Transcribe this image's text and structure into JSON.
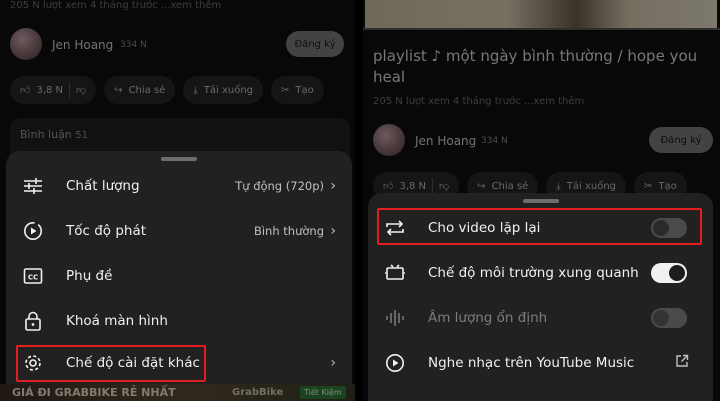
{
  "left": {
    "meta": "205 N lượt xem  4 tháng trước  ...xem thêm",
    "channel": {
      "name": "Jen Hoang",
      "subs": "334 N",
      "subscribe_label": "Đăng ký"
    },
    "actions": {
      "likes": "3,8 N",
      "share": "Chia sẻ",
      "download": "Tải xuống",
      "clip": "Tạo"
    },
    "comments": {
      "label": "Bình luận",
      "count": "51"
    },
    "menu": [
      {
        "label": "Chất lượng",
        "value": "Tự động (720p)",
        "icon": "sliders-icon"
      },
      {
        "label": "Tốc độ phát",
        "value": "Bình thường",
        "icon": "playback-speed-icon"
      },
      {
        "label": "Phụ đề",
        "value": "",
        "icon": "captions-icon"
      },
      {
        "label": "Khoá màn hình",
        "value": "",
        "icon": "lock-icon"
      },
      {
        "label": "Chế độ cài đặt khác",
        "value": "",
        "icon": "gear-icon"
      }
    ],
    "banner": {
      "text": "GIÁ ĐI GRABBIKE RẺ NHẤT",
      "tag": "Tiết Kiệm",
      "brand": "GrabBike"
    }
  },
  "right": {
    "title": "playlist ♪ một ngày bình thường / hope you heal",
    "meta": "205 N lượt xem  4 tháng trước  ...xem thêm",
    "channel": {
      "name": "Jen Hoang",
      "subs": "334 N",
      "subscribe_label": "Đăng ký"
    },
    "actions": {
      "likes": "3,8 N",
      "share": "Chia sẻ",
      "download": "Tải xuống",
      "clip": "Tạo"
    },
    "menu": [
      {
        "label": "Cho video lặp lại",
        "state": "off",
        "icon": "repeat-icon"
      },
      {
        "label": "Chế độ môi trường xung quanh",
        "state": "on",
        "icon": "ambient-tv-icon"
      },
      {
        "label": "Âm lượng ổn định",
        "state": "off-disabled",
        "icon": "stable-volume-icon"
      },
      {
        "label": "Nghe nhạc trên YouTube Music",
        "state": "external",
        "icon": "youtube-music-icon"
      }
    ]
  },
  "colors": {
    "highlight": "#e41e1e",
    "sheet": "#212121",
    "background": "#0f0f0f"
  }
}
